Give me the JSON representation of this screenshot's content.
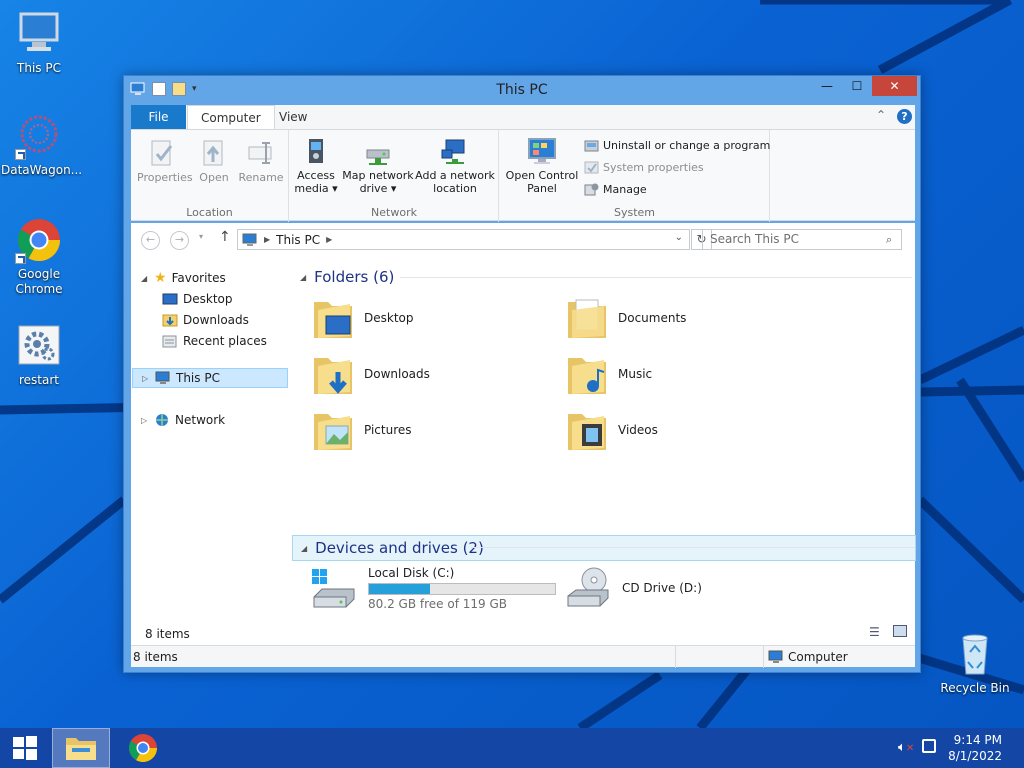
{
  "desktop": {
    "icons": [
      {
        "label": "This PC"
      },
      {
        "label": "DataWagon..."
      },
      {
        "label": "Google Chrome"
      },
      {
        "label": "restart"
      },
      {
        "label": "Recycle Bin"
      }
    ]
  },
  "window": {
    "title": "This PC",
    "controls": {
      "minimize": "—",
      "maximize": "☐",
      "close": "✕"
    },
    "tabs": [
      {
        "label": "File"
      },
      {
        "label": "Computer"
      },
      {
        "label": "View"
      }
    ],
    "ribbon": {
      "location": {
        "label": "Location",
        "buttons": [
          {
            "label": "Properties"
          },
          {
            "label": "Open"
          },
          {
            "label": "Rename"
          }
        ]
      },
      "network": {
        "label": "Network",
        "buttons": [
          {
            "line1": "Access",
            "line2": "media ▾"
          },
          {
            "line1": "Map network",
            "line2": "drive ▾"
          },
          {
            "line1": "Add a network",
            "line2": "location"
          }
        ]
      },
      "system": {
        "label": "System",
        "open_control_panel": {
          "line1": "Open Control",
          "line2": "Panel"
        },
        "items": [
          {
            "label": "Uninstall or change a program"
          },
          {
            "label": "System properties"
          },
          {
            "label": "Manage"
          }
        ]
      }
    },
    "address": {
      "path": "This PC"
    },
    "search": {
      "placeholder": "Search This PC"
    },
    "nav": {
      "favorites": "Favorites",
      "items": [
        {
          "label": "Desktop"
        },
        {
          "label": "Downloads"
        },
        {
          "label": "Recent places"
        }
      ],
      "this_pc": "This PC",
      "network": "Network"
    },
    "folders": {
      "heading": "Folders (6)",
      "items": [
        {
          "label": "Desktop"
        },
        {
          "label": "Documents"
        },
        {
          "label": "Downloads"
        },
        {
          "label": "Music"
        },
        {
          "label": "Pictures"
        },
        {
          "label": "Videos"
        }
      ]
    },
    "devices": {
      "heading": "Devices and drives (2)",
      "items": [
        {
          "label": "Local Disk (C:)",
          "free_text": "80.2 GB free of 119 GB",
          "used_fraction": 0.33
        },
        {
          "label": "CD Drive (D:)"
        }
      ]
    },
    "status": {
      "items_count": "8 items",
      "items_count_bottom": "8 items",
      "location": "Computer"
    }
  },
  "taskbar": {
    "time": "9:14 PM",
    "date": "8/1/2022"
  },
  "colors": {
    "accent": "#1979ca",
    "window_frame": "#63a6e8",
    "close_button": "#c7463c",
    "taskbar": "#1346a5",
    "disk_bar": "#26a0da"
  }
}
